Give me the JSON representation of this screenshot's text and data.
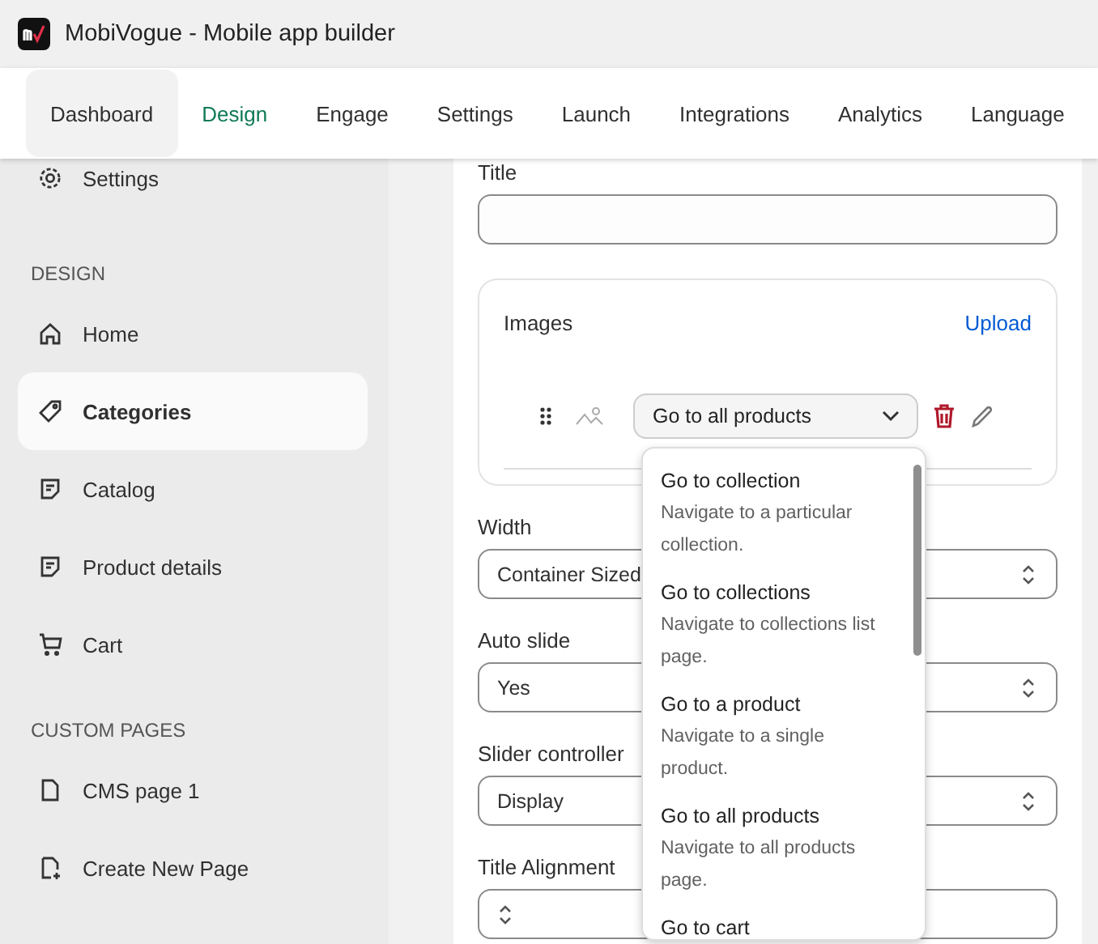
{
  "window": {
    "title": "MobiVogue - Mobile app builder"
  },
  "tabs": [
    {
      "label": "Dashboard",
      "selected": false,
      "hovered": true
    },
    {
      "label": "Design",
      "selected": true,
      "hovered": false
    },
    {
      "label": "Engage",
      "selected": false,
      "hovered": false
    },
    {
      "label": "Settings",
      "selected": false,
      "hovered": false
    },
    {
      "label": "Launch",
      "selected": false,
      "hovered": false
    },
    {
      "label": "Integrations",
      "selected": false,
      "hovered": false
    },
    {
      "label": "Analytics",
      "selected": false,
      "hovered": false
    },
    {
      "label": "Language",
      "selected": false,
      "hovered": false
    }
  ],
  "sidebar": {
    "sections": [
      {
        "items": [
          {
            "label": "Settings",
            "selected": false
          }
        ]
      },
      {
        "header": "DESIGN",
        "items": [
          {
            "label": "Home",
            "selected": false
          },
          {
            "label": "Categories",
            "selected": true
          },
          {
            "label": "Catalog",
            "selected": false
          },
          {
            "label": "Product details",
            "selected": false
          },
          {
            "label": "Cart",
            "selected": false
          }
        ]
      },
      {
        "header": "CUSTOM PAGES",
        "items": [
          {
            "label": "CMS page 1",
            "selected": false
          },
          {
            "label": "Create New Page",
            "selected": false
          }
        ]
      }
    ]
  },
  "form": {
    "title_label": "Title",
    "images": {
      "label": "Images",
      "upload": "Upload",
      "link_select": "Go to all products"
    },
    "selects": [
      {
        "label": "Width",
        "value": "Container Sized"
      },
      {
        "label": "Auto slide",
        "value": "Yes"
      },
      {
        "label": "Slider controller",
        "value": "Display"
      },
      {
        "label": "Title Alignment"
      }
    ]
  },
  "dropdown_menu": [
    {
      "title": "Go to collection",
      "description": "Navigate to a particular collection."
    },
    {
      "title": "Go to collections",
      "description": "Navigate to collections list page."
    },
    {
      "title": "Go to a product",
      "description": "Navigate to a single product."
    },
    {
      "title": "Go to all products",
      "description": "Navigate to all products page."
    },
    {
      "title": "Go to cart"
    }
  ]
}
